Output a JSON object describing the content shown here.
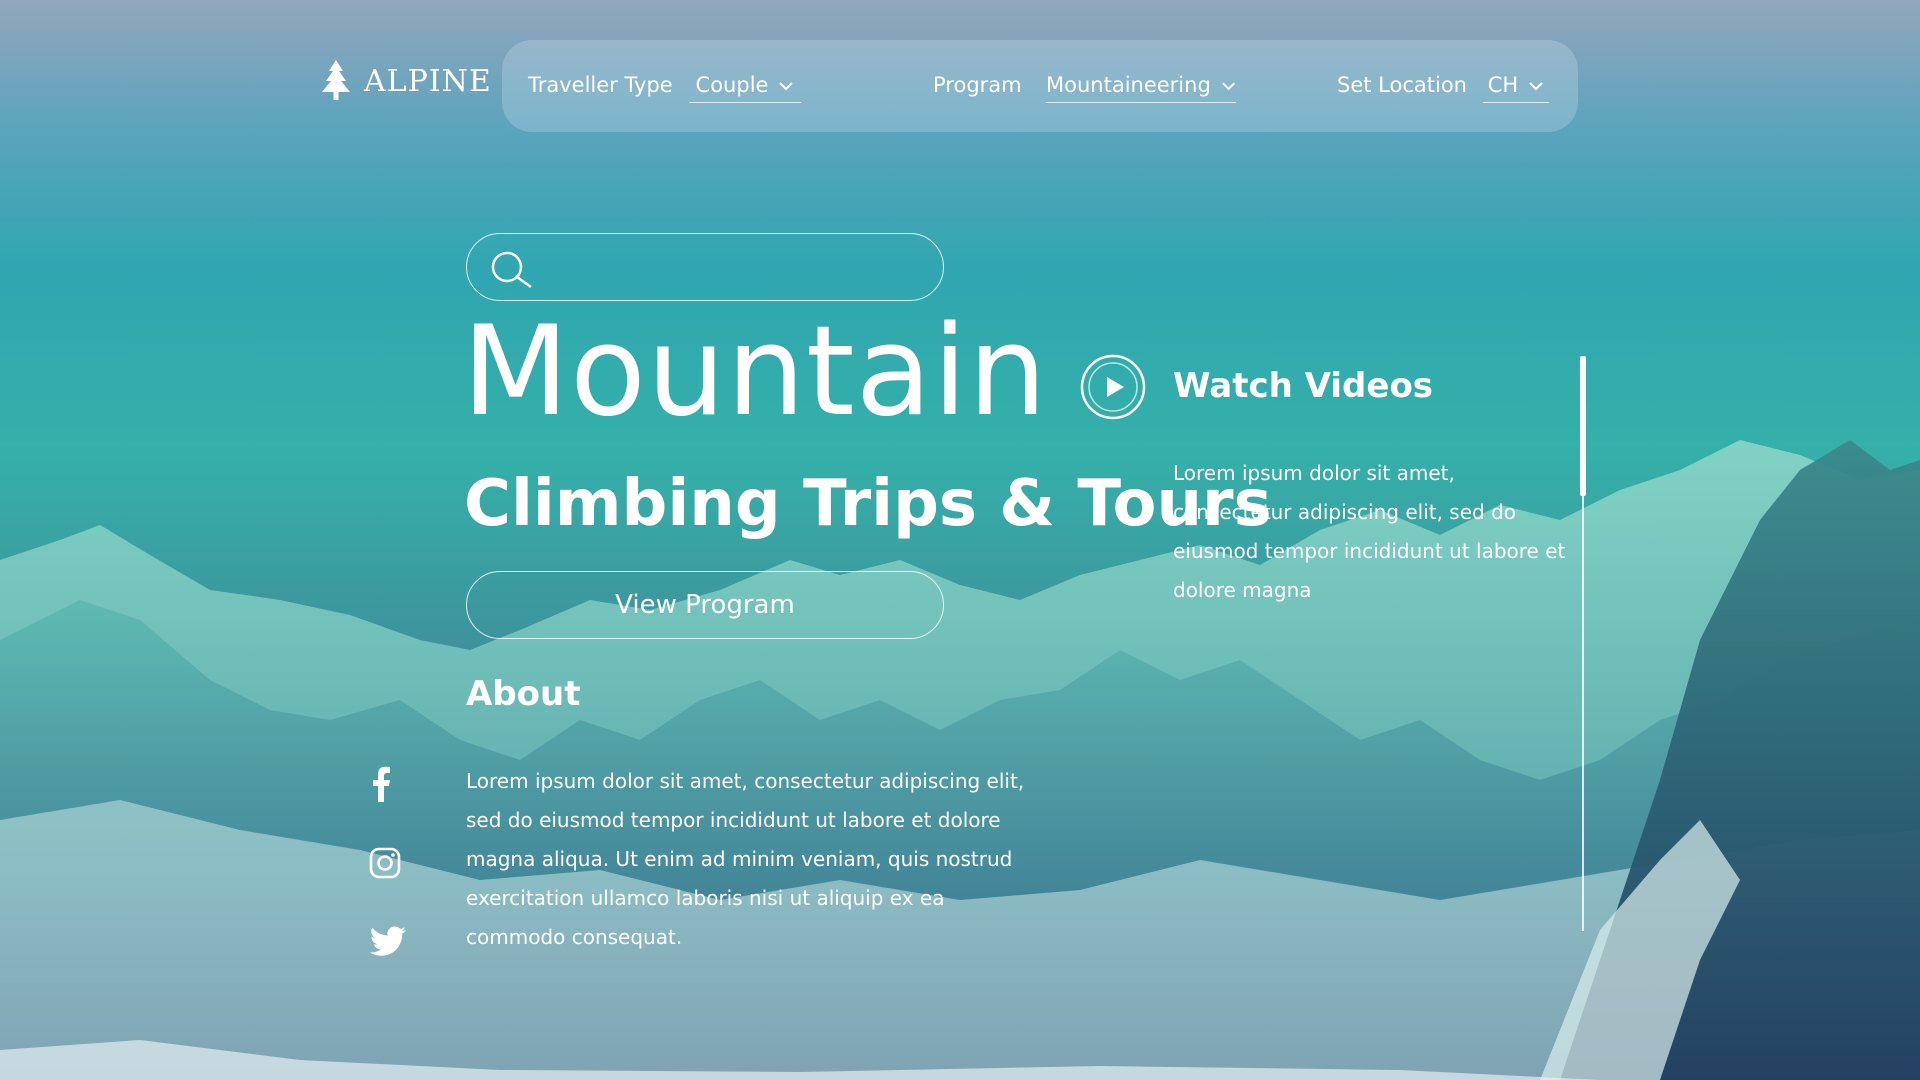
{
  "brand": {
    "name": "ALPINE",
    "icon": "pine-tree-icon"
  },
  "nav": {
    "traveller_type_label": "Traveller Type",
    "traveller_type_value": "Couple",
    "program_label": "Program",
    "program_value": "Mountaineering",
    "location_label": "Set Location",
    "location_value": "CH"
  },
  "search": {
    "placeholder": "",
    "icon": "search-icon"
  },
  "hero": {
    "title": "Mountain",
    "subtitle": "Climbing Trips & Tours",
    "cta_label": "View Program"
  },
  "about": {
    "heading": "About",
    "text": "Lorem ipsum dolor sit amet, consectetur adipiscing elit, sed do eiusmod tempor incididunt ut labore et dolore magna aliqua. Ut enim ad minim veniam, quis nostrud exercitation ullamco laboris nisi ut aliquip ex ea commodo consequat."
  },
  "social": [
    {
      "icon": "facebook-icon"
    },
    {
      "icon": "instagram-icon"
    },
    {
      "icon": "twitter-icon"
    }
  ],
  "videos": {
    "heading": "Watch Videos",
    "text": "Lorem ipsum dolor sit amet, consectetur adipiscing elit, sed do eiusmod tempor incididunt ut labore et dolore magna",
    "icon": "play-icon"
  },
  "colors": {
    "text": "#ffffff",
    "sky_top": "#93a6bd",
    "teal": "#2fa6b1",
    "deep_blue": "#203f68"
  }
}
